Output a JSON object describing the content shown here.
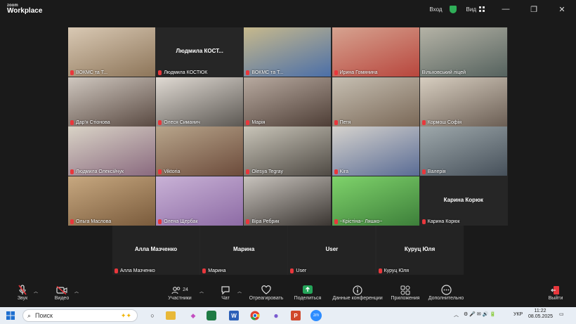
{
  "app": {
    "logo_small": "zoom",
    "logo_main": "Workplace"
  },
  "titlebar": {
    "signin": "Вход",
    "view": "Вид",
    "minimize": "—",
    "restore": "❐",
    "close": "✕"
  },
  "gallery": [
    {
      "name": "ВОКМС та Т...",
      "big": "",
      "c1": "#d9c9b4",
      "c2": "#8d7559",
      "muted": true
    },
    {
      "name": "Людмила КОСТЮК",
      "big": "Людмила  КОСТ...",
      "c1": "",
      "c2": "",
      "muted": true
    },
    {
      "name": "ВОКМС та Т...",
      "big": "",
      "c1": "#c7b98c",
      "c2": "#4b6fa8",
      "muted": true
    },
    {
      "name": "Ирина Гомянина",
      "big": "",
      "c1": "#d6a390",
      "c2": "#b8463d",
      "muted": true,
      "active": true
    },
    {
      "name": "Вільховський ліцей",
      "big": "",
      "c1": "#b5b3a6",
      "c2": "#55625e",
      "muted": false
    },
    {
      "name": "Дар'я Стіонова",
      "big": "",
      "c1": "#cfc7bf",
      "c2": "#5a4a42",
      "muted": true
    },
    {
      "name": "Олеся Симанич",
      "big": "",
      "c1": "#e0dad3",
      "c2": "#5c5853",
      "muted": true
    },
    {
      "name": "Марія",
      "big": "",
      "c1": "#b8aaa0",
      "c2": "#4e3e36",
      "muted": true
    },
    {
      "name": "Петя",
      "big": "",
      "c1": "#c6bfb2",
      "c2": "#7a6857",
      "muted": true
    },
    {
      "name": "Кормош Софія",
      "big": "",
      "c1": "#d7cec0",
      "c2": "#6b5e54",
      "muted": true
    },
    {
      "name": "Людмила Олексійчук",
      "big": "",
      "c1": "#d9d3c6",
      "c2": "#8a6a7f",
      "muted": true
    },
    {
      "name": "Viktoria",
      "big": "",
      "c1": "#b8a58b",
      "c2": "#6c4b3b",
      "muted": true
    },
    {
      "name": "Olesya Tegray",
      "big": "",
      "c1": "#c8c4b8",
      "c2": "#4f4a44",
      "muted": true
    },
    {
      "name": "Kira",
      "big": "",
      "c1": "#d5d2cd",
      "c2": "#5a6c95",
      "muted": true
    },
    {
      "name": "Валерія",
      "big": "",
      "c1": "#9ea8ab",
      "c2": "#46505a",
      "muted": true
    },
    {
      "name": "Ольга Маслова",
      "big": "",
      "c1": "#c7a880",
      "c2": "#7a5b3c",
      "muted": true
    },
    {
      "name": "Олена Щербак",
      "big": "",
      "c1": "#c9b2d6",
      "c2": "#8d6ba5",
      "muted": true
    },
    {
      "name": "Віра Ребрик",
      "big": "",
      "c1": "#c8c3bd",
      "c2": "#3b3632",
      "muted": true
    },
    {
      "name": "~Крістіна~ Ляшко~",
      "big": "",
      "c1": "#7fd36b",
      "c2": "#3d7f3a",
      "muted": true
    },
    {
      "name": "Карина Корюк",
      "big": "Карина Корюк",
      "c1": "",
      "c2": "",
      "muted": true
    }
  ],
  "gallery2": [
    {
      "name": "Алла Мазченко",
      "big": "Алла Мазченко",
      "muted": true
    },
    {
      "name": "Марина",
      "big": "Марина",
      "muted": true
    },
    {
      "name": "User",
      "big": "User",
      "muted": true
    },
    {
      "name": "Куруц Юля",
      "big": "Куруц Юля",
      "muted": true
    }
  ],
  "toolbar": {
    "sound": "Звук",
    "video": "Видео",
    "participants": "Участники",
    "participants_count": "24",
    "chat": "Чат",
    "react": "Отреагировать",
    "share": "Поделиться",
    "meeting_data": "Данные конференции",
    "apps": "Приложения",
    "more": "Дополнительно",
    "leave": "Выйти"
  },
  "taskbar": {
    "search": "Поиск",
    "lang": "УКР",
    "time": "11:22",
    "date": "08.05.2025"
  },
  "colors": {
    "accent_green": "#2fae58",
    "muted_red": "#e8373c",
    "share_green": "#25a55a"
  }
}
